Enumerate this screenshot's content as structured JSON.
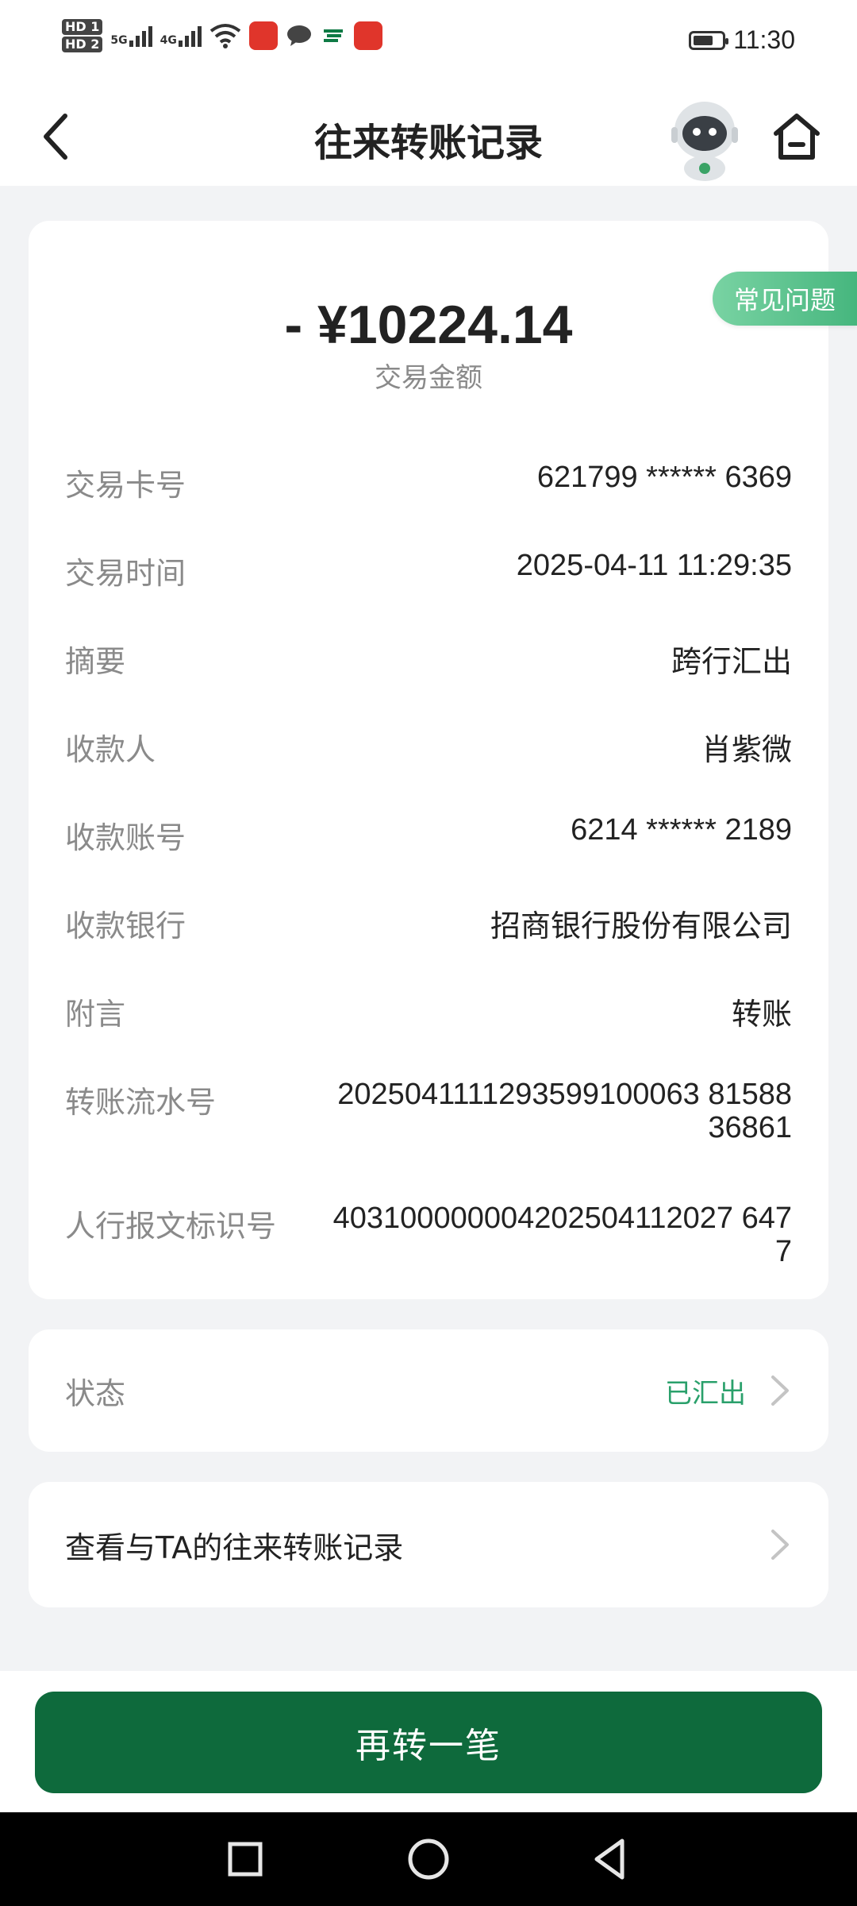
{
  "status_bar": {
    "hd1": "HD 1",
    "hd2": "HD 2",
    "net1": "5G",
    "net2": "4G",
    "time": "11:30"
  },
  "header": {
    "title": "往来转账记录"
  },
  "transaction": {
    "faq_label": "常见问题",
    "amount": "- ¥10224.14",
    "amount_label": "交易金额",
    "fields": [
      {
        "label": "交易卡号",
        "value": "621799 ****** 6369"
      },
      {
        "label": "交易时间",
        "value": "2025-04-11 11:29:35"
      },
      {
        "label": "摘要",
        "value": "跨行汇出"
      },
      {
        "label": "收款人",
        "value": "肖紫微"
      },
      {
        "label": "收款账号",
        "value": "6214 ****** 2189"
      },
      {
        "label": "收款银行",
        "value": "招商银行股份有限公司"
      },
      {
        "label": "附言",
        "value": "转账"
      },
      {
        "label": "转账流水号",
        "value": "2025041111293599100063 8158836861"
      },
      {
        "label": "人行报文标识号",
        "value": "403100000004202504112027 6477"
      }
    ]
  },
  "status_card": {
    "label": "状态",
    "value": "已汇出"
  },
  "history_card": {
    "label": "查看与TA的往来转账记录"
  },
  "actions": {
    "transfer_again": "再转一笔"
  },
  "colors": {
    "primary": "#0e6a3c",
    "status_green": "#2aa06b",
    "faq_gradient_start": "#79d3a3",
    "faq_gradient_end": "#46b67e"
  }
}
